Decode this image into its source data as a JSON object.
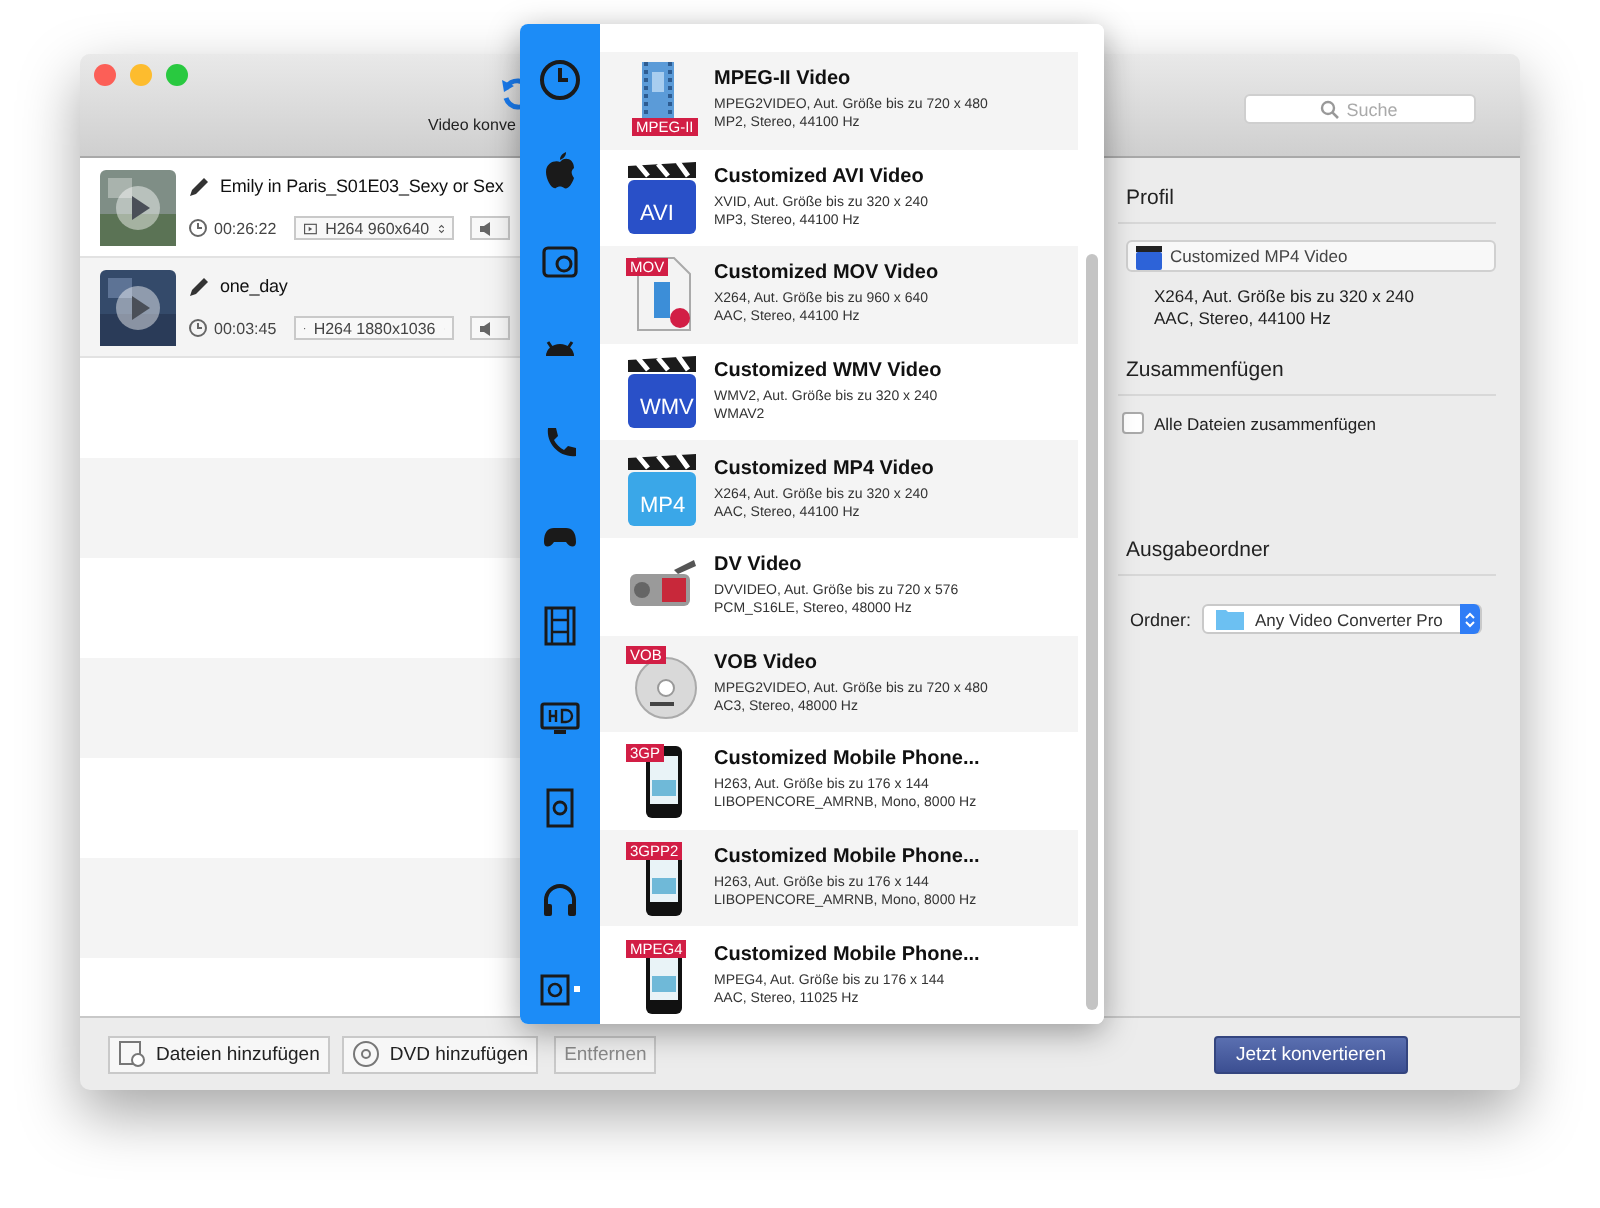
{
  "toolbar": {
    "convert_label": "Video konve",
    "search": {
      "placeholder": "Suche"
    }
  },
  "files": [
    {
      "title": "Emily in Paris_S01E03_Sexy or Sex",
      "duration": "00:26:22",
      "video_format": "H264 960x640"
    },
    {
      "title": "one_day",
      "duration": "00:03:45",
      "video_format": "H264 1880x1036"
    }
  ],
  "profiles": [
    {
      "kind": "strip",
      "name": "MPEG-II Video",
      "line1": "MPEG2VIDEO, Aut. Größe bis zu 720 x 480",
      "line2": "MP2, Stereo, 44100 Hz",
      "badge": "MPEG-II"
    },
    {
      "kind": "clapper",
      "name": "Customized AVI Video",
      "line1": "XVID, Aut. Größe bis zu 320 x 240",
      "line2": "MP3, Stereo, 44100 Hz",
      "badge": "AVI"
    },
    {
      "kind": "document",
      "name": "Customized MOV Video",
      "line1": "X264, Aut. Größe bis zu 960 x 640",
      "line2": "AAC, Stereo, 44100 Hz",
      "badge": "MOV"
    },
    {
      "kind": "clapper",
      "name": "Customized WMV Video",
      "line1": "WMV2, Aut. Größe bis zu 320 x 240",
      "line2": "WMAV2",
      "badge": "WMV"
    },
    {
      "kind": "clapper",
      "name": "Customized MP4 Video",
      "line1": "X264, Aut. Größe bis zu 320 x 240",
      "line2": "AAC, Stereo, 44100 Hz",
      "badge": "MP4"
    },
    {
      "kind": "camcorder",
      "name": "DV Video",
      "line1": "DVVIDEO, Aut. Größe bis zu 720 x 576",
      "line2": "PCM_S16LE, Stereo, 48000 Hz"
    },
    {
      "kind": "disc",
      "name": "VOB Video",
      "line1": "MPEG2VIDEO, Aut. Größe bis zu 720 x 480",
      "line2": "AC3, Stereo, 48000 Hz",
      "badge": "VOB"
    },
    {
      "kind": "phone",
      "name": "Customized Mobile Phone...",
      "line1": "H263, Aut. Größe bis zu 176 x 144",
      "line2": "LIBOPENCORE_AMRNB, Mono, 8000 Hz",
      "badge": "3GP"
    },
    {
      "kind": "phone",
      "name": "Customized Mobile Phone...",
      "line1": "H263, Aut. Größe bis zu 176 x 144",
      "line2": "LIBOPENCORE_AMRNB, Mono, 8000 Hz",
      "badge": "3GPP2"
    },
    {
      "kind": "phone",
      "name": "Customized Mobile Phone...",
      "line1": "MPEG4, Aut. Größe bis zu 176 x 144",
      "line2": "AAC, Stereo, 11025 Hz",
      "badge": "MPEG4"
    }
  ],
  "settings": {
    "profile_heading": "Profil",
    "profile": "Customized MP4 Video",
    "profile_line1": "X264, Aut. Größe bis zu 320 x 240",
    "profile_line2": "AAC, Stereo, 44100 Hz",
    "merge_heading": "Zusammenfügen",
    "merge": {
      "label": "Alle Dateien zusammenfügen",
      "checked": false
    },
    "output_heading": "Ausgabeordner",
    "folder_label": "Ordner:",
    "folder": "Any Video Converter Pro"
  },
  "buttons": [
    {
      "kind": "add",
      "label": "Dateien hinzufügen",
      "disabled": false
    },
    {
      "kind": "dvd",
      "label": "DVD hinzufügen",
      "disabled": false
    },
    {
      "kind": "remove",
      "label": "Entfernen",
      "disabled": true
    }
  ],
  "convert_button": "Jetzt konvertieren"
}
